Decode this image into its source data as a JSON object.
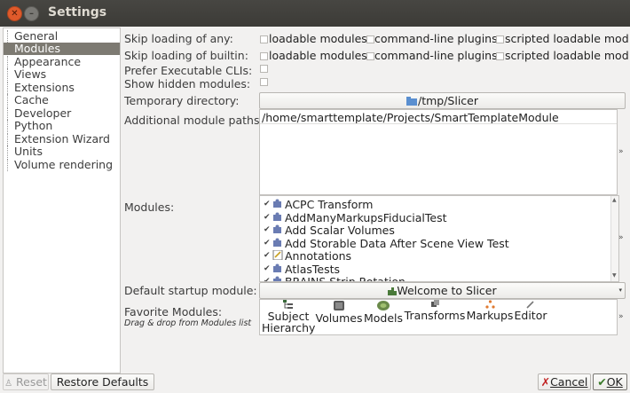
{
  "window": {
    "title": "Settings"
  },
  "sidebar": {
    "items": [
      {
        "label": "General"
      },
      {
        "label": "Modules"
      },
      {
        "label": "Appearance"
      },
      {
        "label": "Views"
      },
      {
        "label": "Extensions"
      },
      {
        "label": "Cache"
      },
      {
        "label": "Developer"
      },
      {
        "label": "Python"
      },
      {
        "label": "Extension Wizard"
      },
      {
        "label": "Units"
      },
      {
        "label": "Volume rendering"
      }
    ]
  },
  "form": {
    "skip_any_label": "Skip loading of any:",
    "skip_builtin_label": "Skip loading of builtin:",
    "skip_options": [
      "loadable modules",
      "command-line plugins",
      "scripted loadable mod"
    ],
    "prefer_cli_label": "Prefer Executable CLIs:",
    "show_hidden_label": "Show hidden modules:",
    "temp_dir_label": "Temporary directory:",
    "temp_dir_value": "/tmp/Slicer",
    "add_paths_label": "Additional module paths:",
    "add_paths": [
      "/home/smarttemplate/Projects/SmartTemplateModule"
    ],
    "modules_label": "Modules:",
    "modules": [
      {
        "name": "ACPC Transform",
        "icon": "puzzle-icon"
      },
      {
        "name": "AddManyMarkupsFiducialTest",
        "icon": "puzzle-icon"
      },
      {
        "name": "Add Scalar Volumes",
        "icon": "puzzle-icon"
      },
      {
        "name": "Add Storable Data After Scene View Test",
        "icon": "puzzle-icon"
      },
      {
        "name": "Annotations",
        "icon": "annotations-icon"
      },
      {
        "name": "AtlasTests",
        "icon": "puzzle-icon"
      },
      {
        "name": "BRAINS Strip Rotation",
        "icon": "puzzle-icon"
      }
    ],
    "startup_label": "Default startup module:",
    "startup_value": "Welcome to Slicer",
    "favorites_label": "Favorite Modules:",
    "favorites_hint": "Drag & drop from Modules list",
    "favorites": [
      {
        "line1": "Subject",
        "line2": "Hierarchy"
      },
      {
        "line1": "Volumes",
        "line2": ""
      },
      {
        "line1": "Models",
        "line2": ""
      },
      {
        "line1": "Transforms",
        "line2": ""
      },
      {
        "line1": "Markups",
        "line2": ""
      },
      {
        "line1": "Editor",
        "line2": ""
      }
    ],
    "more_glyph": "»"
  },
  "footer": {
    "reset": "Reset",
    "restore": "Restore Defaults",
    "cancel": "Cancel",
    "ok": "OK"
  }
}
